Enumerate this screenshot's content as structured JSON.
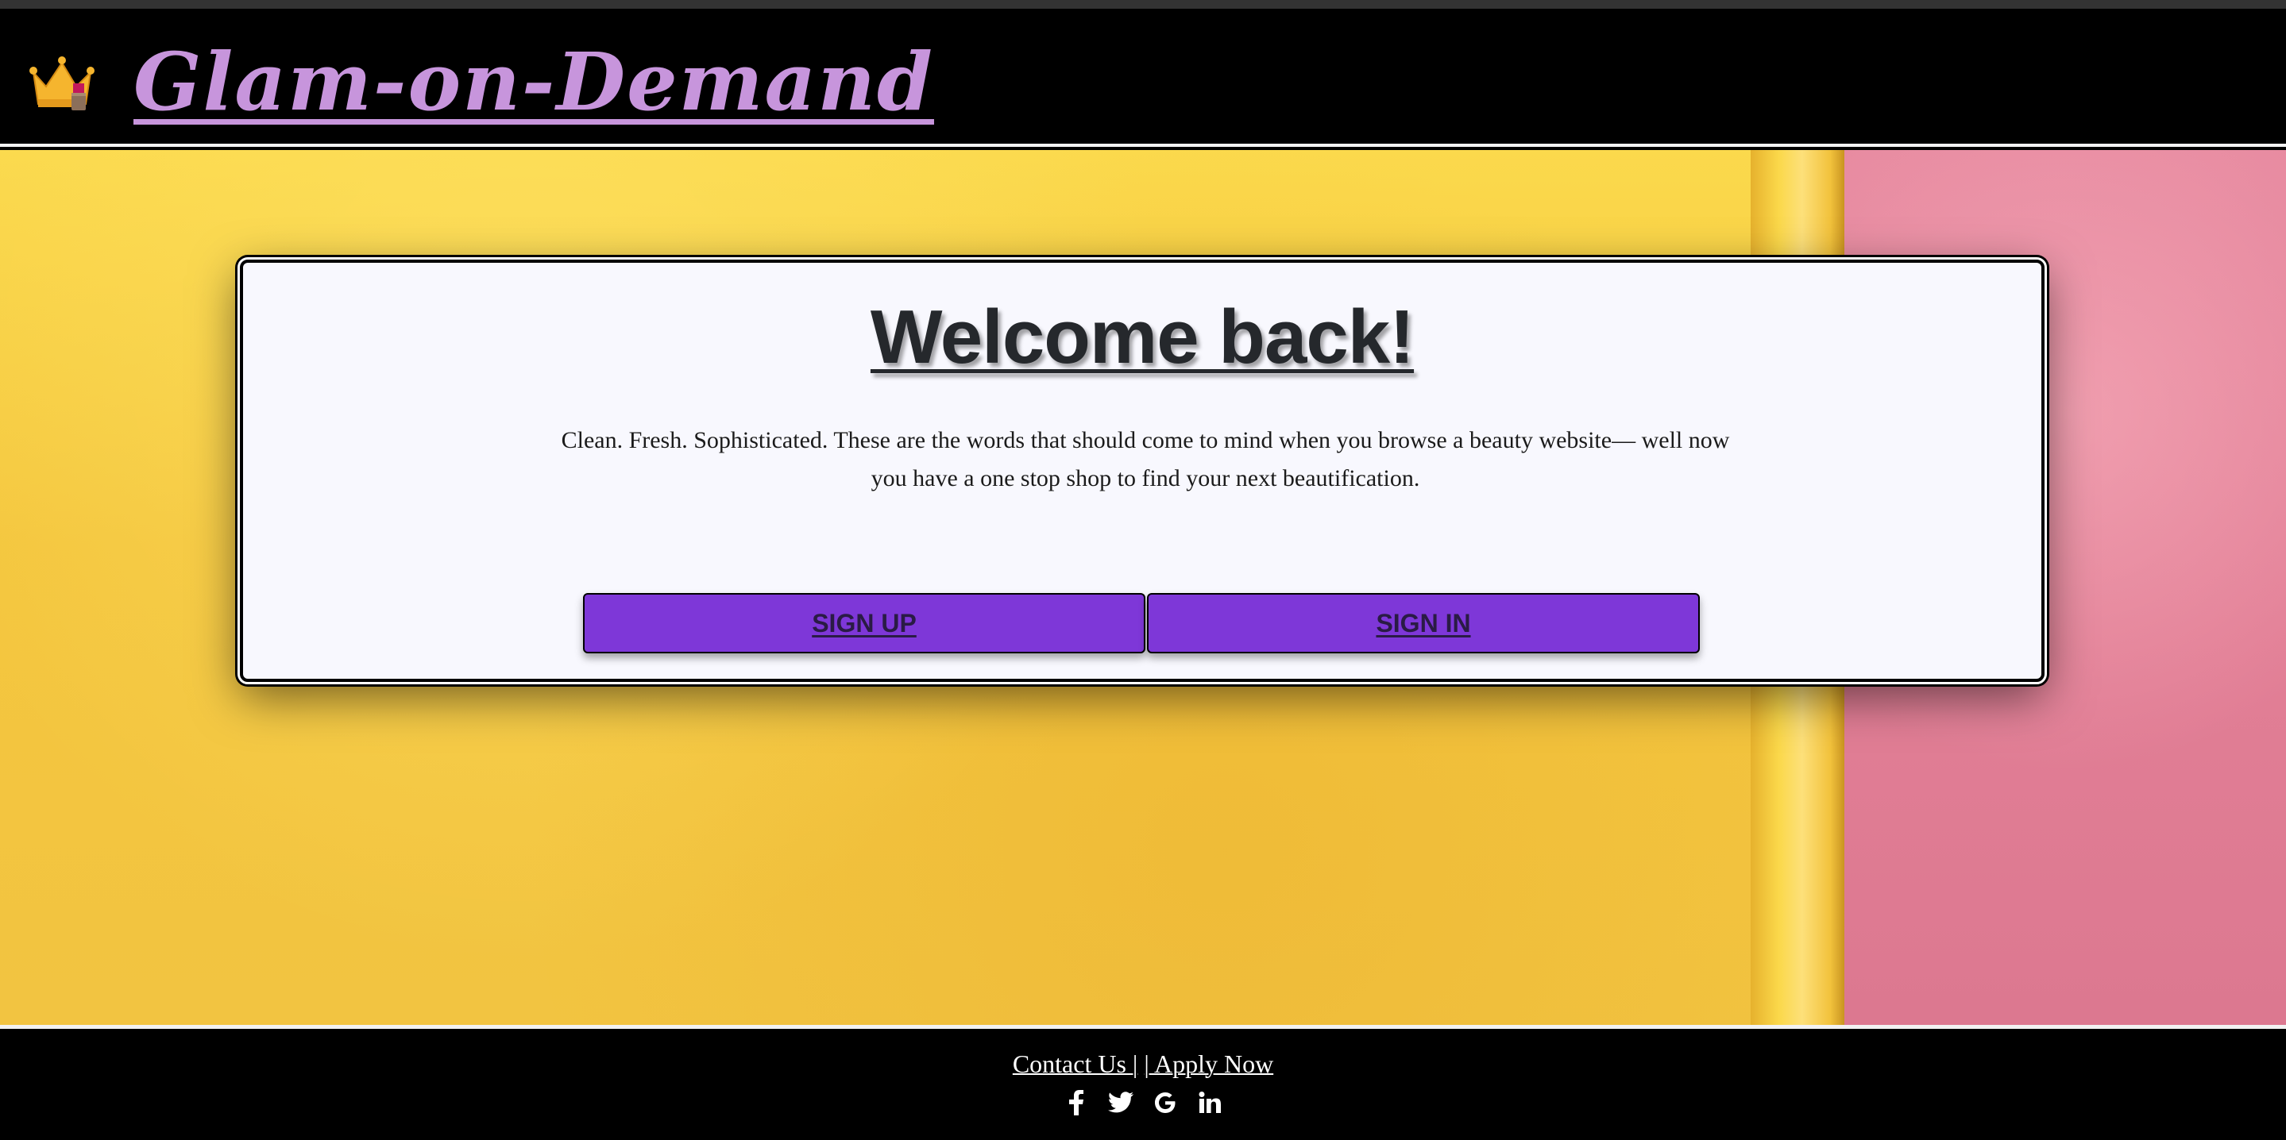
{
  "header": {
    "brand": "Glam-on-Demand",
    "logo_icon": "crown-lipstick-icon"
  },
  "colors": {
    "brand": "#c795dc",
    "button": "#7e37d8",
    "header_bg": "#000000",
    "card_bg": "#f8f8fe",
    "wall_yellow": "#f4c93f",
    "wall_pink": "#e27f96"
  },
  "card": {
    "title": "Welcome back!",
    "description": "Clean. Fresh. Sophisticated. These are the words that should come to mind when you browse a beauty website— well now you have a one stop shop to find your next beautification.",
    "signup_label": "SIGN UP",
    "signin_label": "SIGN IN"
  },
  "footer": {
    "contact_label": "Contact Us |",
    "apply_label": "| Apply Now",
    "social": [
      {
        "name": "facebook-icon",
        "glyph": "f"
      },
      {
        "name": "twitter-icon",
        "glyph": ""
      },
      {
        "name": "google-icon",
        "glyph": "G"
      },
      {
        "name": "linkedin-icon",
        "glyph": "in"
      }
    ]
  }
}
